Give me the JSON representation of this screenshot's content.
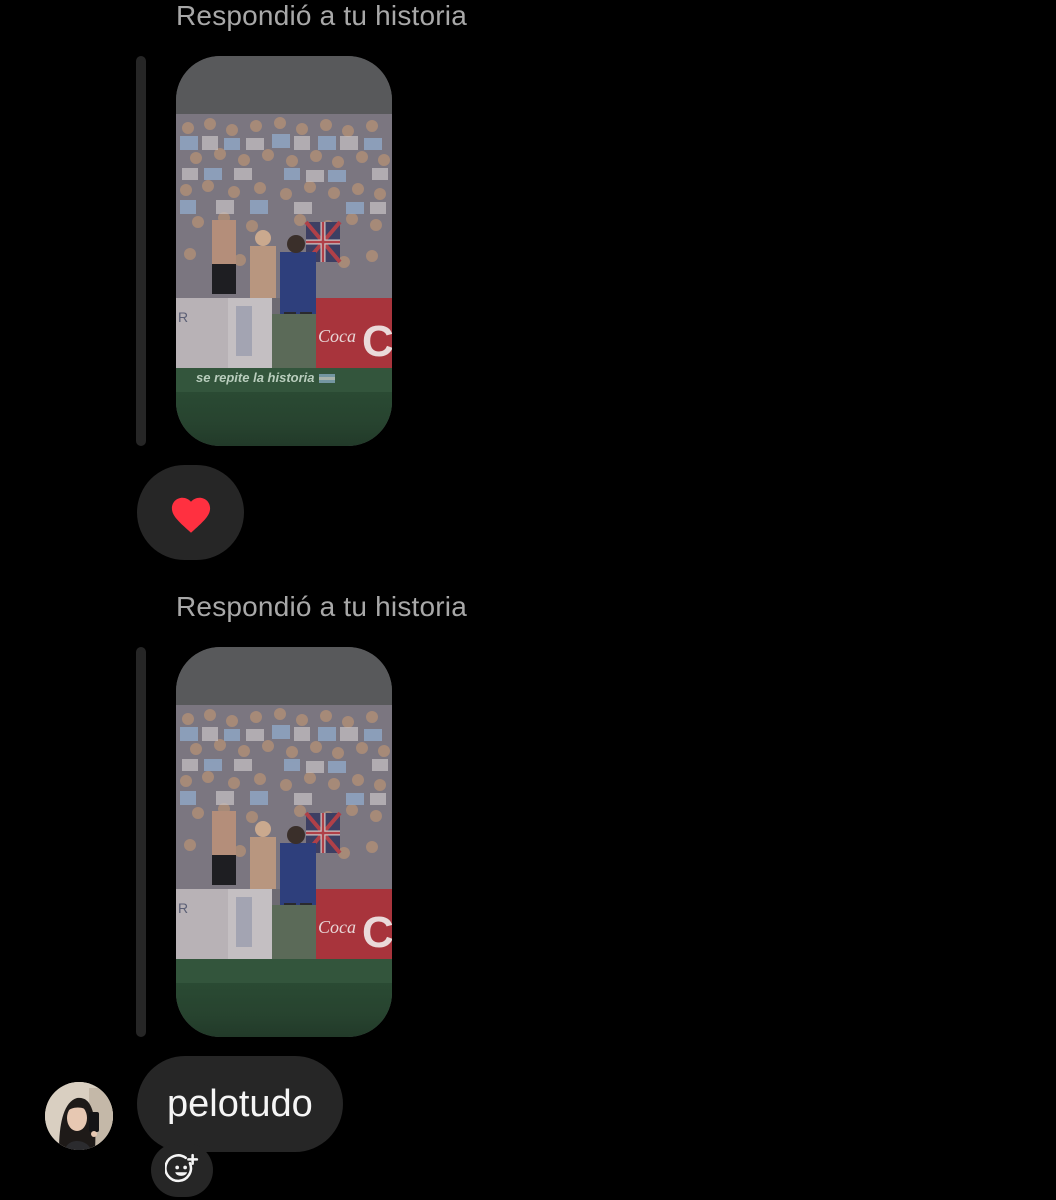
{
  "messages": [
    {
      "reply_label": "Respondió a tu historia",
      "story_caption": "se repite la historia",
      "caption_flag_icon": "argentina-flag-icon",
      "reaction": {
        "icon": "red-heart-icon",
        "color": "#ff3040"
      }
    },
    {
      "reply_label": "Respondió a tu historia",
      "story_caption": "",
      "text": "pelotudo",
      "react_icon": "add-reaction-icon"
    }
  ],
  "colors": {
    "background": "#000000",
    "bubble": "#262626",
    "reply_label": "#a8a8a8",
    "message_text": "#f5f5f5"
  }
}
